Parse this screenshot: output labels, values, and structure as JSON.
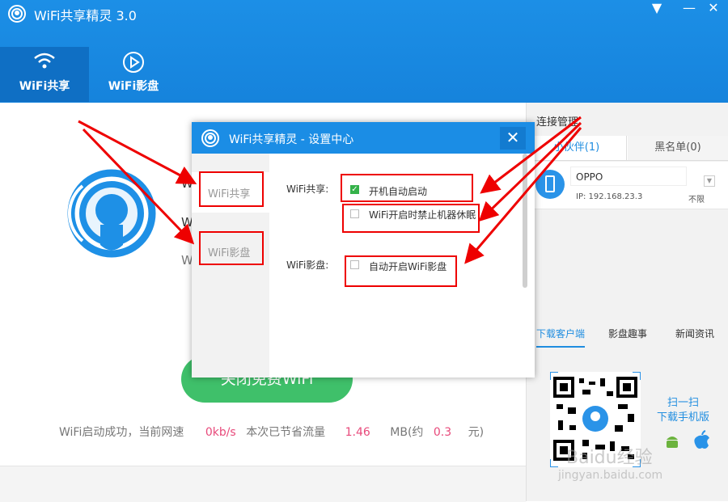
{
  "app": {
    "title": "WiFi共享精灵 3.0"
  },
  "window_controls": {
    "menu": "▼",
    "minimize": "—",
    "close": "✕"
  },
  "nav": {
    "tabs": [
      {
        "label": "WiFi共享",
        "icon": "wifi-icon",
        "active": true
      },
      {
        "label": "WiFi影盘",
        "icon": "play-icon",
        "active": false
      }
    ]
  },
  "main": {
    "fragments": [
      "W",
      "W",
      "W"
    ],
    "close_button": "关闭免费WiFi",
    "status": {
      "prefix": "WiFi启动成功，当前网速",
      "speed": "0kb/s",
      "saved_label": "本次已节省流量",
      "saved_value": "1.46",
      "unit_prefix": "MB(约",
      "yuan_value": "0.3",
      "unit_suffix": "元)"
    }
  },
  "right": {
    "title": "连接管理",
    "tabs": [
      "小伙伴(1)",
      "黑名单(0)"
    ],
    "device": {
      "name": "OPPO",
      "ip": "IP: 192.168.23.3",
      "limit": "不限"
    },
    "bottom_tabs": [
      "下载客户端",
      "影盘趣事",
      "新闻资讯"
    ],
    "scan_line1": "扫一扫",
    "scan_line2": "下载手机版"
  },
  "dialog": {
    "title": "WiFi共享精灵 - 设置中心",
    "close": "✕",
    "sidebar": [
      "WiFi共享",
      "WiFi影盘"
    ],
    "share_label": "WiFi共享:",
    "share_options": [
      {
        "label": "开机自动启动",
        "checked": true
      },
      {
        "label": "WiFi开启时禁止机器休眠",
        "checked": false
      }
    ],
    "video_label": "WiFi影盘:",
    "video_options": [
      {
        "label": "自动开启WiFi影盘",
        "checked": false
      }
    ]
  },
  "watermark": {
    "line1": "Baidu经验",
    "line2": "jingyan.baidu.com"
  },
  "colors": {
    "brand_blue": "#1b8de5",
    "green": "#3fc06a",
    "annotation_red": "#e00000",
    "pink": "#e84a7b"
  }
}
